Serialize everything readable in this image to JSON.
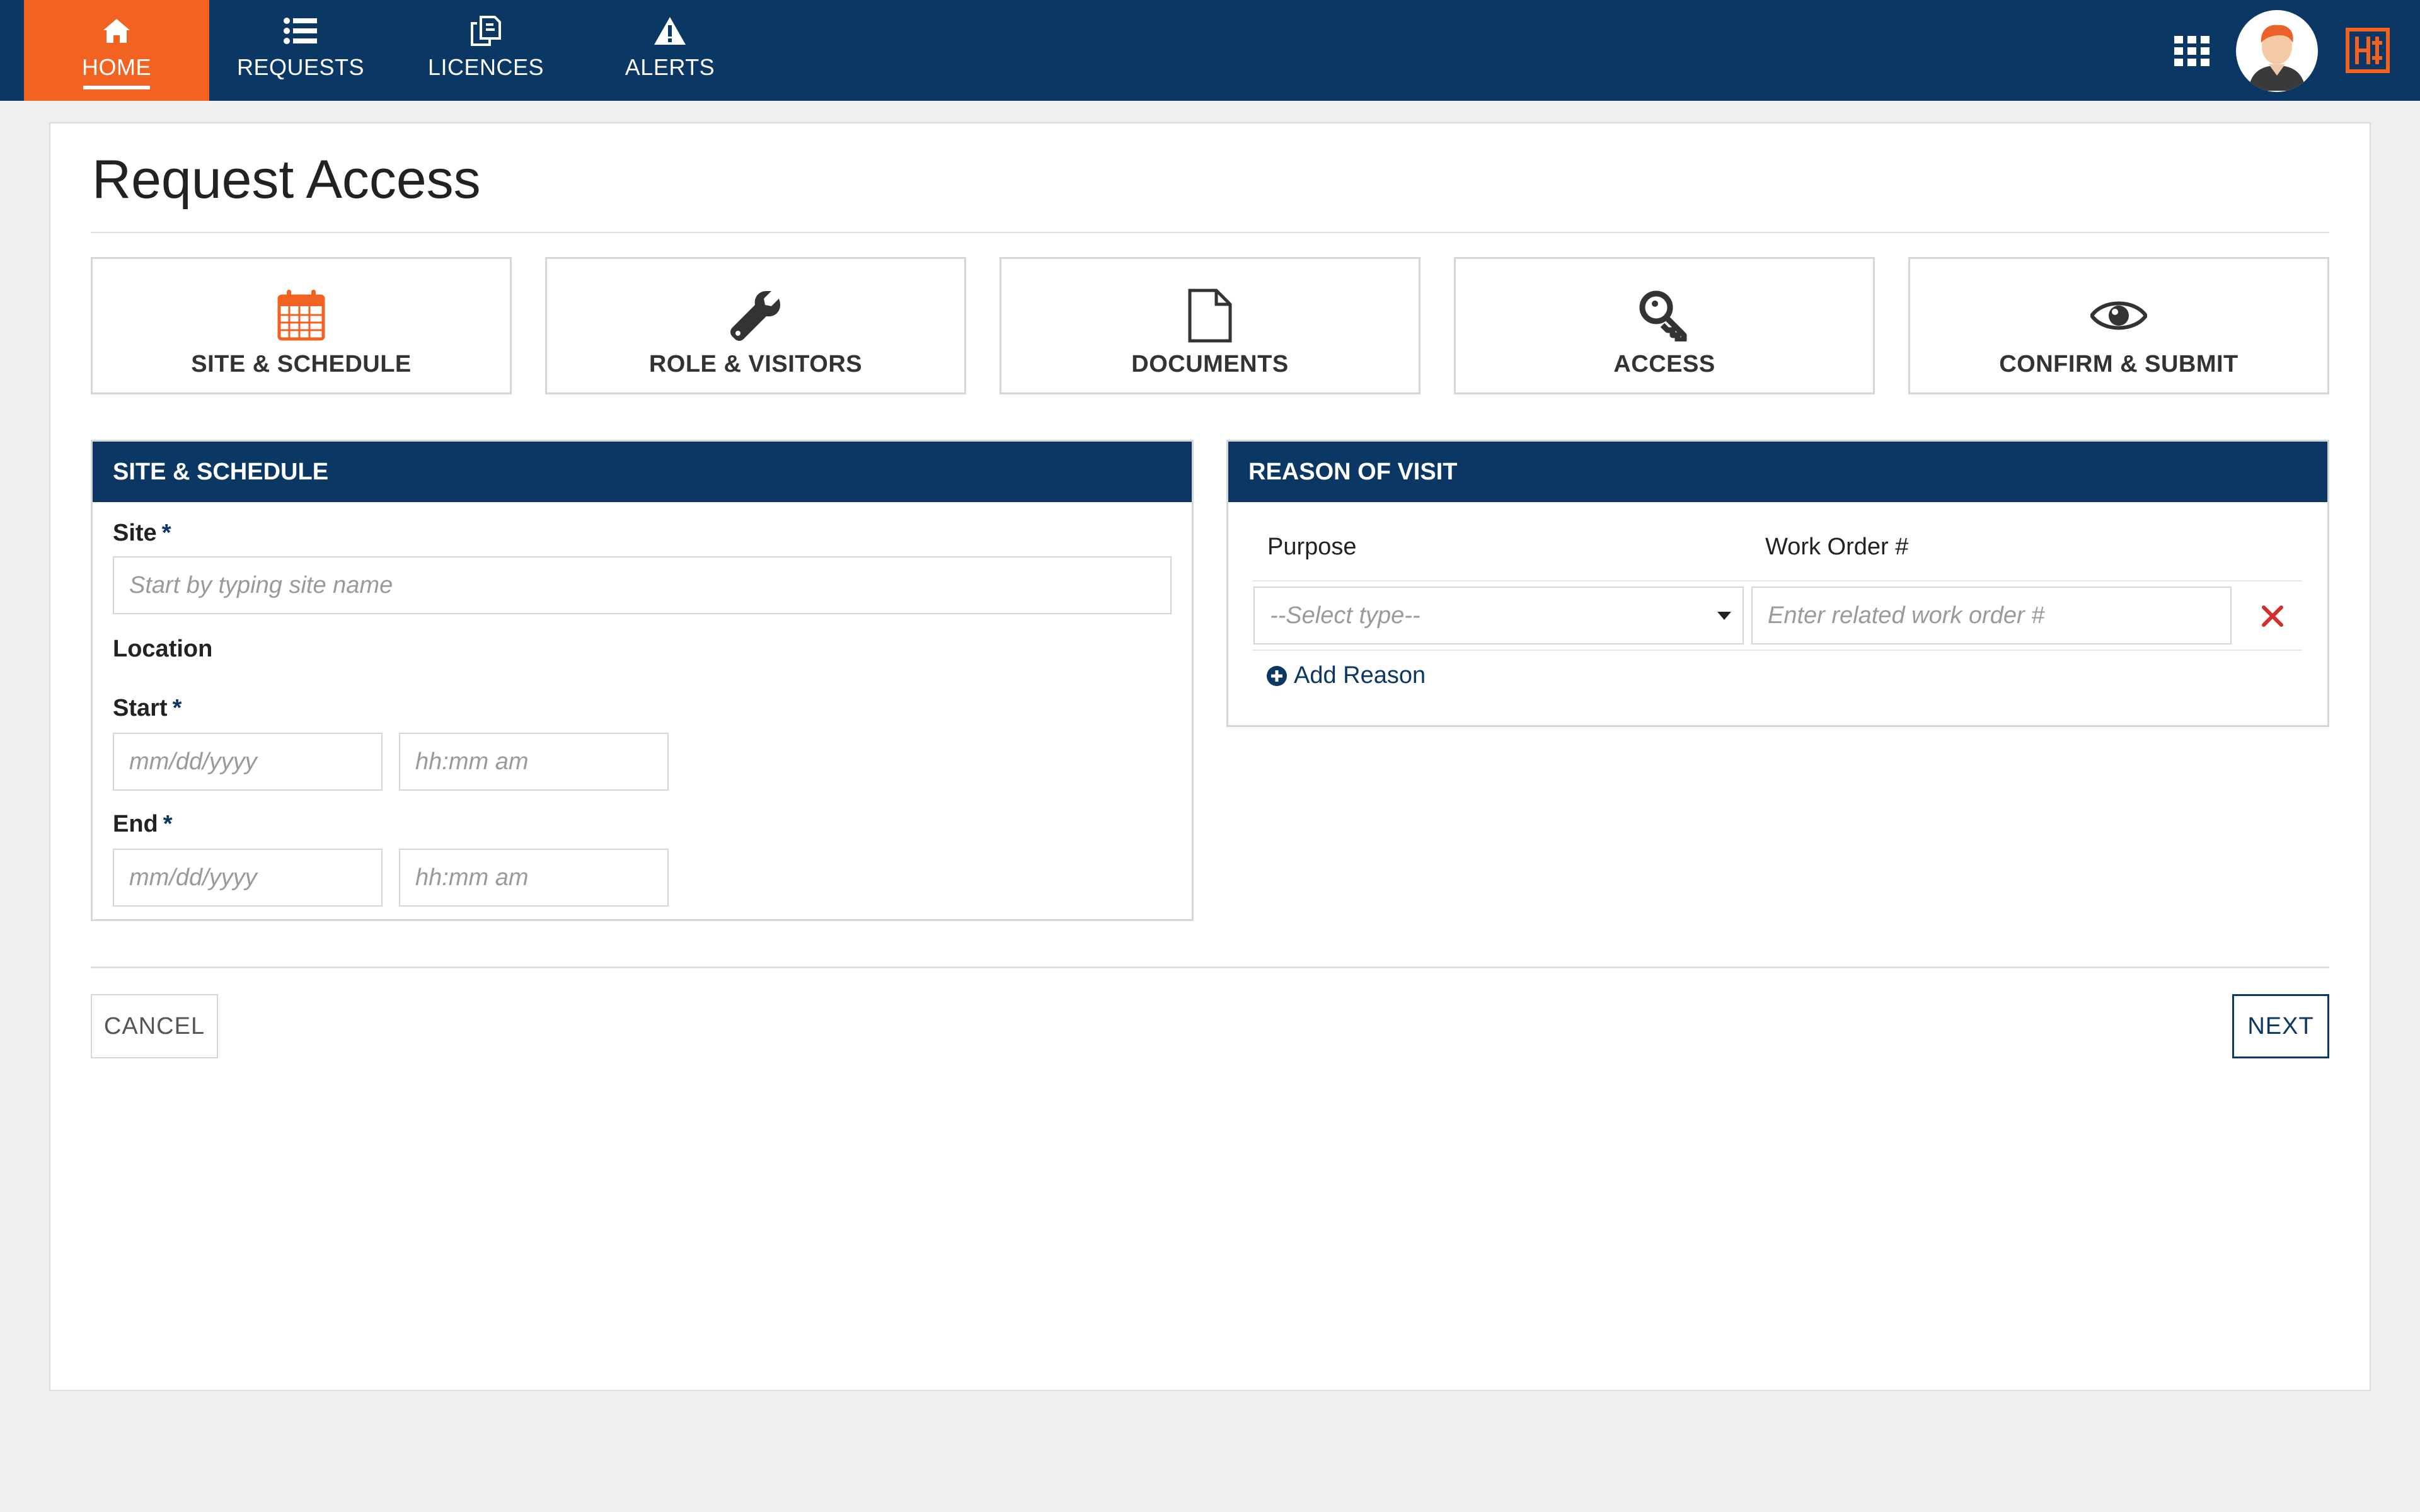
{
  "nav": {
    "items": [
      {
        "label": "HOME",
        "icon": "home-icon",
        "active": true
      },
      {
        "label": "REQUESTS",
        "icon": "list-icon",
        "active": false
      },
      {
        "label": "LICENCES",
        "icon": "documents-icon",
        "active": false
      },
      {
        "label": "ALERTS",
        "icon": "warning-icon",
        "active": false
      }
    ],
    "right": {
      "apps_icon": "grid-icon",
      "avatar": "user-avatar",
      "logo": "brand-logo"
    }
  },
  "colors": {
    "nav_bg": "#0a3764",
    "accent": "#f26322",
    "danger": "#d32f2f",
    "border": "#d6d6d6"
  },
  "page": {
    "title": "Request Access"
  },
  "steps": [
    {
      "label": "SITE & SCHEDULE",
      "icon": "calendar-icon",
      "active": true
    },
    {
      "label": "ROLE & VISITORS",
      "icon": "wrench-icon",
      "active": false
    },
    {
      "label": "DOCUMENTS",
      "icon": "document-icon",
      "active": false
    },
    {
      "label": "ACCESS",
      "icon": "key-icon",
      "active": false
    },
    {
      "label": "CONFIRM & SUBMIT",
      "icon": "eye-icon",
      "active": false
    }
  ],
  "site_schedule": {
    "header": "SITE & SCHEDULE",
    "site_label": "Site",
    "site_placeholder": "Start by typing site name",
    "location_label": "Location",
    "start_label": "Start",
    "end_label": "End",
    "required_mark": "*",
    "date_placeholder": "mm/dd/yyyy",
    "time_placeholder": "hh:mm am"
  },
  "reason_of_visit": {
    "header": "REASON OF VISIT",
    "purpose_label": "Purpose",
    "work_order_label": "Work Order #",
    "select_placeholder": "--Select type--",
    "work_order_placeholder": "Enter related work order #",
    "add_reason_label": "Add Reason"
  },
  "actions": {
    "cancel_label": "CANCEL",
    "next_label": "NEXT"
  }
}
